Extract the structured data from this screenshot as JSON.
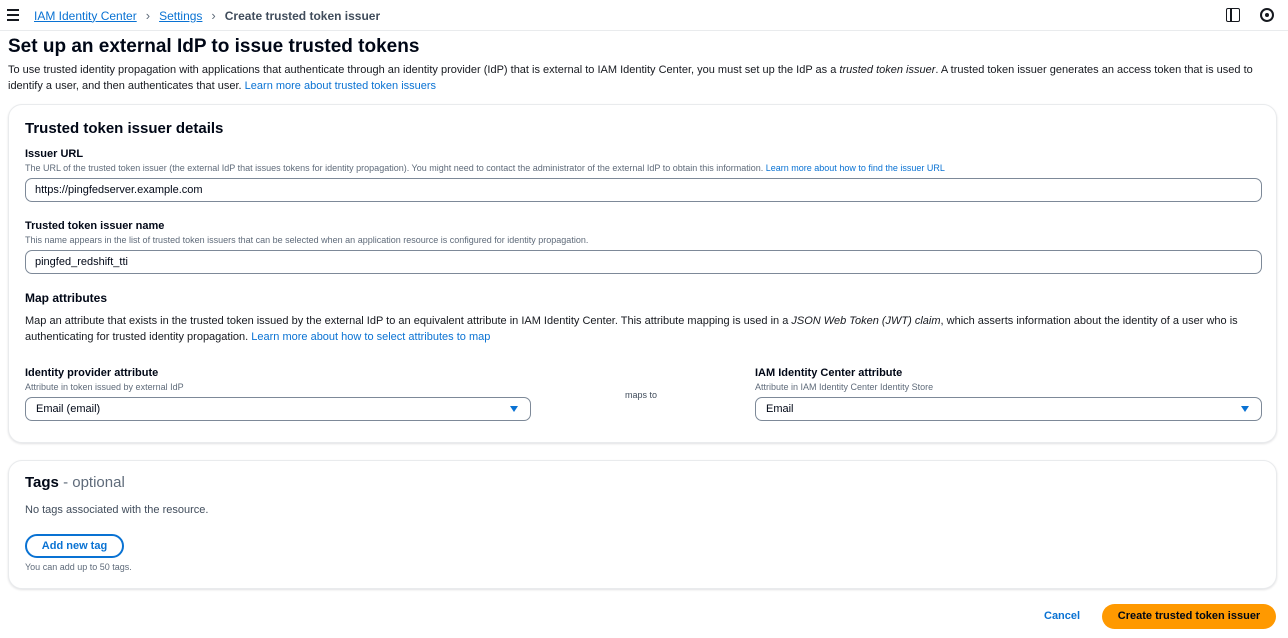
{
  "breadcrumb": {
    "items": [
      "IAM Identity Center",
      "Settings"
    ],
    "current": "Create trusted token issuer"
  },
  "icons": {
    "menu": "hamburger-icon",
    "panel": "split-panel-icon",
    "settings": "gear-icon",
    "separator": "chevron-right-icon",
    "dropdown": "caret-down-icon"
  },
  "page": {
    "title": "Set up an external IdP to issue trusted tokens",
    "desc_part1": "To use trusted identity propagation with applications that authenticate through an identity provider (IdP) that is external to IAM Identity Center, you must set up the IdP as a ",
    "desc_italic": "trusted token issuer",
    "desc_part2": ". A trusted token issuer generates an access token that is used to identify a user, and then authenticates that user. ",
    "desc_link": "Learn more about trusted token issuers"
  },
  "details": {
    "title": "Trusted token issuer details",
    "issuer_url": {
      "label": "Issuer URL",
      "desc": "The URL of the trusted token issuer (the external IdP that issues tokens for identity propagation). You might need to contact the administrator of the external IdP to obtain this information. ",
      "link": "Learn more about how to find the issuer URL",
      "value": "https://pingfedserver.example.com"
    },
    "issuer_name": {
      "label": "Trusted token issuer name",
      "desc": "This name appears in the list of trusted token issuers that can be selected when an application resource is configured for identity propagation.",
      "value": "pingfed_redshift_tti"
    },
    "map": {
      "title": "Map attributes",
      "desc_part1": "Map an attribute that exists in the trusted token issued by the external IdP to an equivalent attribute in IAM Identity Center. This attribute mapping is used in a ",
      "desc_italic": "JSON Web Token (JWT) claim",
      "desc_part2": ", which asserts information about the identity of a user who is authenticating for trusted identity propagation. ",
      "desc_link": "Learn more about how to select attributes to map",
      "idp_label": "Identity provider attribute",
      "idp_desc": "Attribute in token issued by external IdP",
      "idp_value": "Email (email)",
      "maps_to": "maps to",
      "ic_label": "IAM Identity Center attribute",
      "ic_desc": "Attribute in IAM Identity Center Identity Store",
      "ic_value": "Email"
    }
  },
  "tags": {
    "title": "Tags",
    "optional": " - optional",
    "empty": "No tags associated with the resource.",
    "add_button": "Add new tag",
    "hint": "You can add up to 50 tags."
  },
  "footer": {
    "cancel": "Cancel",
    "create": "Create trusted token issuer"
  },
  "colors": {
    "link": "#0972d3",
    "primary_button": "#ff9900",
    "text": "#000716"
  }
}
